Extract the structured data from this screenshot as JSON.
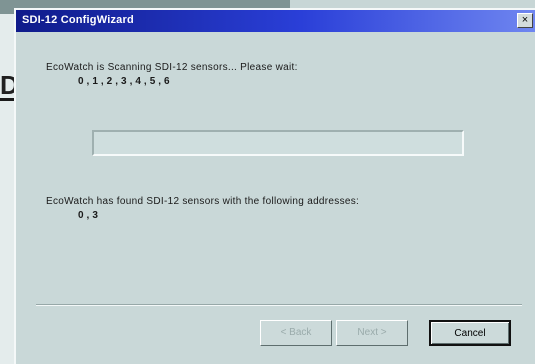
{
  "window": {
    "title": "SDI-12 ConfigWizard",
    "close_label": "×"
  },
  "scan": {
    "message": "EcoWatch is Scanning SDI-12 sensors... Please wait:",
    "addresses": "0,1,2,3,4,5,6",
    "progress_fraction": 0.0
  },
  "result": {
    "message": "EcoWatch has found SDI-12 sensors with the following addresses:",
    "addresses": "0,3"
  },
  "buttons": {
    "back_label": "< Back",
    "next_label": "Next >",
    "cancel_label": "Cancel"
  },
  "background": {
    "glyph": "D"
  }
}
